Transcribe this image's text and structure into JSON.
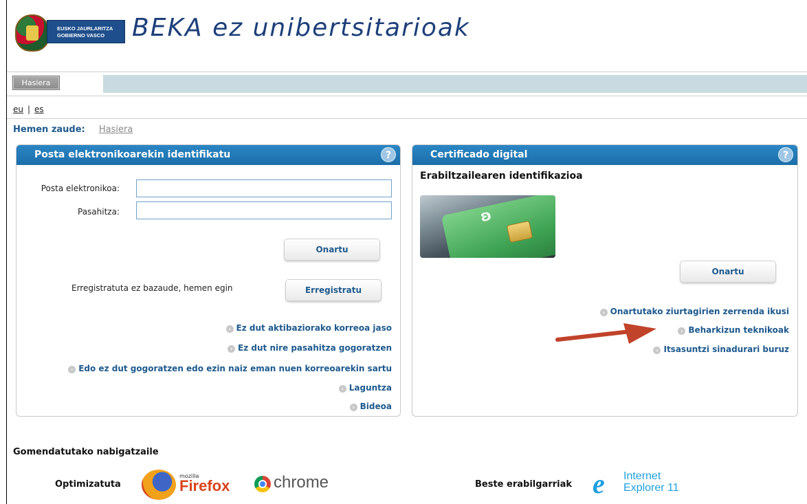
{
  "header": {
    "logo_line1": "EUSKO JAURLARITZA",
    "logo_line2": "GOBIERNO VASCO",
    "app_title": "BEKA ez unibertsitarioak"
  },
  "nav": {
    "home_button": "Hasiera"
  },
  "language": {
    "eu": "eu",
    "es": "es",
    "separator": "|"
  },
  "breadcrumb": {
    "label": "Hemen zaude:",
    "home": "Hasiera"
  },
  "email_panel": {
    "title": "Posta elektronikoarekin identifikatu",
    "help": "?",
    "email_label": "Posta elektronikoa:",
    "email_value": "",
    "password_label": "Pasahitza:",
    "password_value": "",
    "accept_button": "Onartu",
    "register_text": "Erregistratuta ez bazaude, hemen egin",
    "register_button": "Erregistratu",
    "links": [
      "Ez dut aktibaziorako korreoa jaso",
      "Ez dut nire pasahitza gogoratzen",
      "Edo ez dut gogoratzen edo ezin naiz eman nuen korreoarekin sartu",
      "Laguntza",
      "Bideoa"
    ]
  },
  "cert_panel": {
    "title": "Certificado digital",
    "help": "?",
    "subtitle": "Erabiltzailearen identifikazioa",
    "accept_button": "Onartu",
    "links": [
      "Onartutako ziurtagirien zerrenda ikusi",
      "Beharkizun teknikoak",
      "Itsasuntzi sinadurari buruz"
    ]
  },
  "footer": {
    "recommended": "Gomendatutako nabigatzaile",
    "optimized": "Optimizatuta",
    "firefox_small": "mozilla",
    "firefox": "Firefox",
    "chrome": "chrome",
    "others": "Beste erabilgarriak",
    "ie_line1": "Internet",
    "ie_line2": "Explorer 11"
  },
  "colors": {
    "panel_header": "#1c6ea9",
    "link": "#1e5a8e",
    "navbar": "#c9dbe0",
    "annotation_arrow": "#c0432a"
  }
}
